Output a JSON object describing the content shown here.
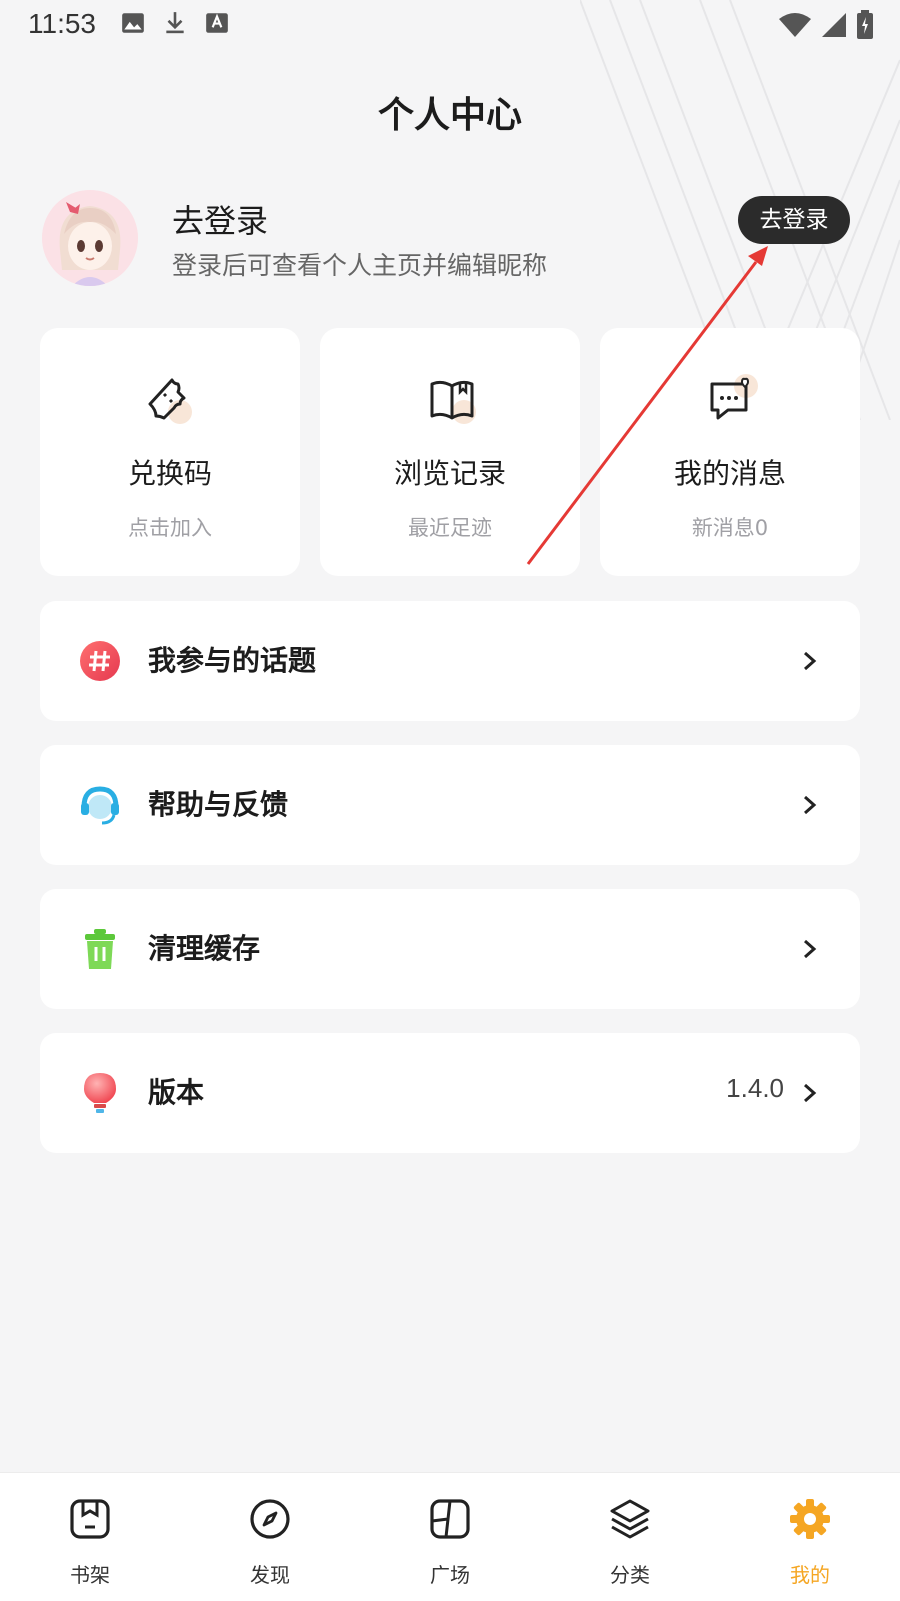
{
  "status_bar": {
    "time": "11:53"
  },
  "page": {
    "title": "个人中心"
  },
  "user": {
    "name": "去登录",
    "subtitle": "登录后可查看个人主页并编辑昵称",
    "login_button": "去登录"
  },
  "quick_actions": [
    {
      "label": "兑换码",
      "sub": "点击加入",
      "icon": "ticket-icon"
    },
    {
      "label": "浏览记录",
      "sub": "最近足迹",
      "icon": "book-icon"
    },
    {
      "label": "我的消息",
      "sub": "新消息0",
      "icon": "message-icon"
    }
  ],
  "menu": [
    {
      "label": "我参与的话题",
      "value": "",
      "icon": "hashtag-icon"
    },
    {
      "label": "帮助与反馈",
      "value": "",
      "icon": "headset-icon"
    },
    {
      "label": "清理缓存",
      "value": "",
      "icon": "trash-icon"
    },
    {
      "label": "版本",
      "value": "1.4.0",
      "icon": "bulb-icon"
    }
  ],
  "tabs": [
    {
      "label": "书架",
      "icon": "bookshelf-icon",
      "active": false
    },
    {
      "label": "发现",
      "icon": "compass-icon",
      "active": false
    },
    {
      "label": "广场",
      "icon": "square-icon",
      "active": false
    },
    {
      "label": "分类",
      "icon": "layers-icon",
      "active": false
    },
    {
      "label": "我的",
      "icon": "gear-icon",
      "active": true
    }
  ],
  "colors": {
    "accent": "#f5a623",
    "login_button": "#2b2b2b",
    "annotation_arrow": "#e53935"
  }
}
